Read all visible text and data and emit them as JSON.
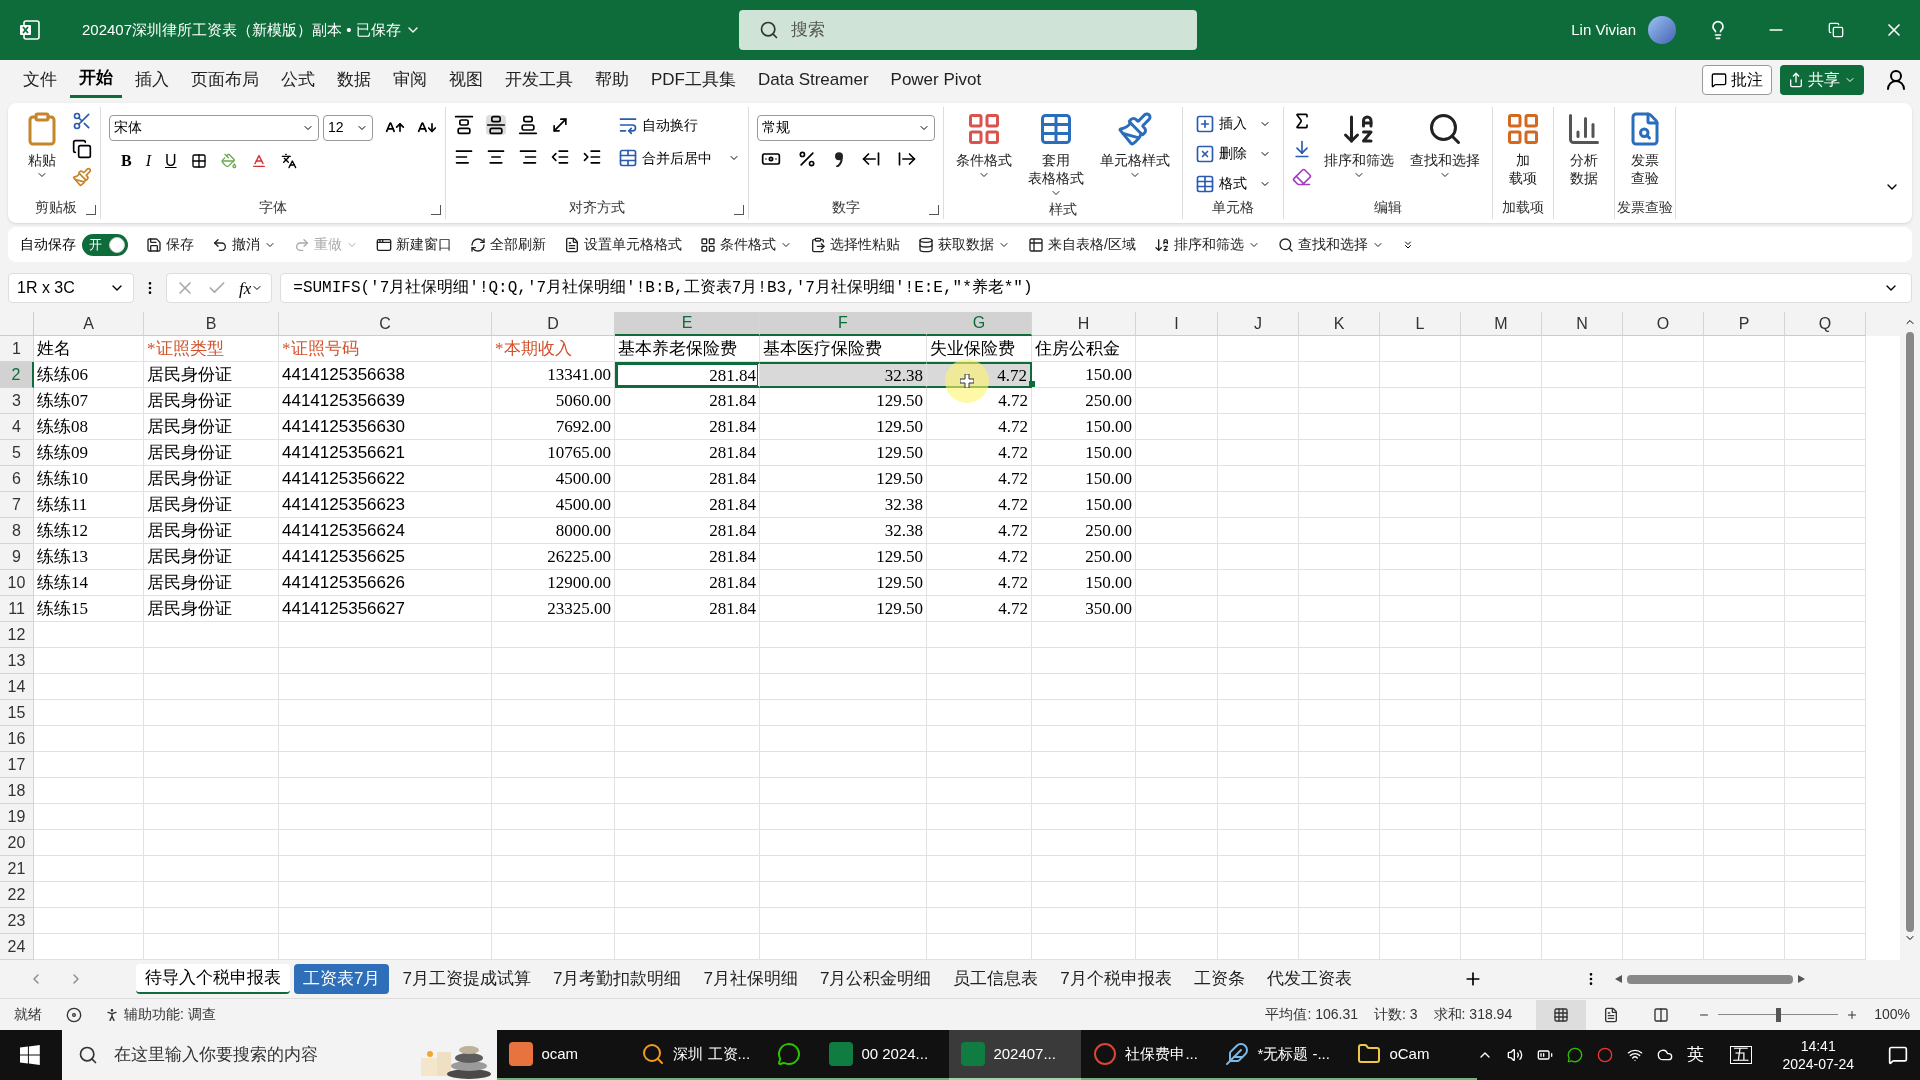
{
  "window": {
    "title": "202407深圳律所工资表（新模版）副本 • 已保存",
    "search_placeholder": "搜索",
    "user": "Lin Vivian"
  },
  "menu": {
    "tabs": [
      {
        "label": "文件",
        "selected": false
      },
      {
        "label": "开始",
        "selected": true
      },
      {
        "label": "插入",
        "selected": false
      },
      {
        "label": "页面布局",
        "selected": false
      },
      {
        "label": "公式",
        "selected": false
      },
      {
        "label": "数据",
        "selected": false
      },
      {
        "label": "审阅",
        "selected": false
      },
      {
        "label": "视图",
        "selected": false
      },
      {
        "label": "开发工具",
        "selected": false
      },
      {
        "label": "帮助",
        "selected": false
      },
      {
        "label": "PDF工具集",
        "selected": false
      },
      {
        "label": "Data Streamer",
        "selected": false
      },
      {
        "label": "Power Pivot",
        "selected": false
      }
    ],
    "comment": "批注",
    "share": "共享"
  },
  "ribbon": [
    {
      "kind": "clipboard",
      "name": "剪贴板",
      "paste": "粘贴"
    },
    {
      "kind": "font",
      "name": "字体",
      "font": "宋体",
      "size": "12",
      "bold": "B",
      "italic": "I",
      "underline": "U"
    },
    {
      "kind": "alignment",
      "name": "对齐方式",
      "wrap": "自动换行",
      "merge": "合并后居中"
    },
    {
      "kind": "number",
      "name": "数字",
      "format": "常规"
    },
    {
      "kind": "styles",
      "name": "样式",
      "buttons": [
        [
          "条件格式"
        ],
        [
          "套用",
          "表格格式"
        ],
        [
          "单元格样式"
        ]
      ]
    },
    {
      "kind": "cells",
      "name": "单元格",
      "buttons": [
        "插入",
        "删除",
        "格式"
      ]
    },
    {
      "kind": "editing",
      "name": "编辑",
      "buttons": [
        "排序和筛选",
        "查找和选择"
      ]
    },
    {
      "kind": "addins",
      "name": "加载项",
      "label": [
        "加",
        "载项"
      ]
    },
    {
      "kind": "analysis",
      "label": [
        "分析",
        "数据"
      ]
    },
    {
      "kind": "invoice",
      "name": "发票查验",
      "label": [
        "发票",
        "查验"
      ]
    }
  ],
  "quick_access": {
    "autosave": "自动保存",
    "toggle": {
      "label": "开",
      "on": true
    },
    "items": [
      {
        "kind": "save",
        "label": "保存",
        "disabled": false,
        "dropdown": false
      },
      {
        "kind": "undo",
        "label": "撤消",
        "disabled": false,
        "dropdown": true
      },
      {
        "kind": "redo",
        "label": "重做",
        "disabled": true,
        "dropdown": true
      },
      {
        "kind": "window",
        "label": "新建窗口",
        "disabled": false,
        "dropdown": false
      },
      {
        "kind": "refresh",
        "label": "全部刷新",
        "disabled": false,
        "dropdown": false
      },
      {
        "kind": "format",
        "label": "设置单元格格式",
        "disabled": false,
        "dropdown": false
      },
      {
        "kind": "conditional",
        "label": "条件格式",
        "disabled": false,
        "dropdown": true
      },
      {
        "kind": "paste",
        "label": "选择性粘贴",
        "disabled": false,
        "dropdown": false
      },
      {
        "kind": "data",
        "label": "获取数据",
        "disabled": false,
        "dropdown": true
      },
      {
        "kind": "table",
        "label": "来自表格/区域",
        "disabled": false,
        "dropdown": false
      },
      {
        "kind": "sort",
        "label": "排序和筛选",
        "disabled": false,
        "dropdown": true
      },
      {
        "kind": "find",
        "label": "查找和选择",
        "disabled": false,
        "dropdown": true
      }
    ]
  },
  "formula_bar": {
    "name_box": "1R x 3C",
    "fx": "fx",
    "formula": "=SUMIFS('7月社保明细'!Q:Q,'7月社保明细'!B:B,工资表7月!B3,'7月社保明细'!E:E,\"*养老*\")"
  },
  "grid": {
    "columns": [
      {
        "letter": "A",
        "kind": "text",
        "selected": false
      },
      {
        "letter": "B",
        "kind": "text",
        "selected": false
      },
      {
        "letter": "C",
        "kind": "id",
        "selected": false
      },
      {
        "letter": "D",
        "kind": "number",
        "selected": false
      },
      {
        "letter": "E",
        "kind": "number",
        "selected": true
      },
      {
        "letter": "F",
        "kind": "number",
        "selected": true
      },
      {
        "letter": "G",
        "kind": "number",
        "selected": true
      },
      {
        "letter": "H",
        "kind": "number",
        "selected": false
      },
      {
        "letter": "I",
        "kind": "text",
        "selected": false
      },
      {
        "letter": "J",
        "kind": "text",
        "selected": false
      },
      {
        "letter": "K",
        "kind": "text",
        "selected": false
      },
      {
        "letter": "L",
        "kind": "text",
        "selected": false
      },
      {
        "letter": "M",
        "kind": "text",
        "selected": false
      },
      {
        "letter": "N",
        "kind": "text",
        "selected": false
      },
      {
        "letter": "O",
        "kind": "text",
        "selected": false
      },
      {
        "letter": "P",
        "kind": "text",
        "selected": false
      },
      {
        "letter": "Q",
        "kind": "text",
        "selected": false
      }
    ],
    "rows": [
      {
        "number": "1",
        "selected": false,
        "cells": [
          {
            "text": "姓名",
            "required": false,
            "selected": false,
            "active": false
          },
          {
            "text": "*证照类型",
            "required": true,
            "selected": false,
            "active": false
          },
          {
            "text": "*证照号码",
            "required": true,
            "selected": false,
            "active": false
          },
          {
            "text": "*本期收入",
            "required": true,
            "selected": false,
            "active": false
          },
          {
            "text": "基本养老保险费",
            "required": false,
            "selected": false,
            "active": false
          },
          {
            "text": "基本医疗保险费",
            "required": false,
            "selected": false,
            "active": false
          },
          {
            "text": "失业保险费",
            "required": false,
            "selected": false,
            "active": false
          },
          {
            "text": "住房公积金",
            "required": false,
            "selected": false,
            "active": false
          }
        ]
      },
      {
        "number": "2",
        "selected": true,
        "cells": [
          {
            "text": "练练06",
            "selected": false,
            "active": false
          },
          {
            "text": "居民身份证",
            "selected": false,
            "active": false
          },
          {
            "text": "4414125356638",
            "selected": false,
            "active": false
          },
          {
            "text": "13341.00",
            "selected": false,
            "active": false
          },
          {
            "text": "281.84",
            "selected": true,
            "active": true
          },
          {
            "text": "32.38",
            "selected": true,
            "active": false
          },
          {
            "text": "4.72",
            "selected": true,
            "active": false
          },
          {
            "text": "150.00",
            "selected": false,
            "active": false
          }
        ]
      },
      {
        "number": "3",
        "selected": false,
        "cells": [
          {
            "text": "练练07",
            "selected": false,
            "active": false
          },
          {
            "text": "居民身份证",
            "selected": false,
            "active": false
          },
          {
            "text": "4414125356639",
            "selected": false,
            "active": false
          },
          {
            "text": "5060.00",
            "selected": false,
            "active": false
          },
          {
            "text": "281.84",
            "selected": false,
            "active": false
          },
          {
            "text": "129.50",
            "selected": false,
            "active": false
          },
          {
            "text": "4.72",
            "selected": false,
            "active": false
          },
          {
            "text": "250.00",
            "selected": false,
            "active": false
          }
        ]
      },
      {
        "number": "4",
        "selected": false,
        "cells": [
          {
            "text": "练练08",
            "selected": false,
            "active": false
          },
          {
            "text": "居民身份证",
            "selected": false,
            "active": false
          },
          {
            "text": "4414125356630",
            "selected": false,
            "active": false
          },
          {
            "text": "7692.00",
            "selected": false,
            "active": false
          },
          {
            "text": "281.84",
            "selected": false,
            "active": false
          },
          {
            "text": "129.50",
            "selected": false,
            "active": false
          },
          {
            "text": "4.72",
            "selected": false,
            "active": false
          },
          {
            "text": "150.00",
            "selected": false,
            "active": false
          }
        ]
      },
      {
        "number": "5",
        "selected": false,
        "cells": [
          {
            "text": "练练09",
            "selected": false,
            "active": false
          },
          {
            "text": "居民身份证",
            "selected": false,
            "active": false
          },
          {
            "text": "4414125356621",
            "selected": false,
            "active": false
          },
          {
            "text": "10765.00",
            "selected": false,
            "active": false
          },
          {
            "text": "281.84",
            "selected": false,
            "active": false
          },
          {
            "text": "129.50",
            "selected": false,
            "active": false
          },
          {
            "text": "4.72",
            "selected": false,
            "active": false
          },
          {
            "text": "150.00",
            "selected": false,
            "active": false
          }
        ]
      },
      {
        "number": "6",
        "selected": false,
        "cells": [
          {
            "text": "练练10",
            "selected": false,
            "active": false
          },
          {
            "text": "居民身份证",
            "selected": false,
            "active": false
          },
          {
            "text": "4414125356622",
            "selected": false,
            "active": false
          },
          {
            "text": "4500.00",
            "selected": false,
            "active": false
          },
          {
            "text": "281.84",
            "selected": false,
            "active": false
          },
          {
            "text": "129.50",
            "selected": false,
            "active": false
          },
          {
            "text": "4.72",
            "selected": false,
            "active": false
          },
          {
            "text": "150.00",
            "selected": false,
            "active": false
          }
        ]
      },
      {
        "number": "7",
        "selected": false,
        "cells": [
          {
            "text": "练练11",
            "selected": false,
            "active": false
          },
          {
            "text": "居民身份证",
            "selected": false,
            "active": false
          },
          {
            "text": "4414125356623",
            "selected": false,
            "active": false
          },
          {
            "text": "4500.00",
            "selected": false,
            "active": false
          },
          {
            "text": "281.84",
            "selected": false,
            "active": false
          },
          {
            "text": "32.38",
            "selected": false,
            "active": false
          },
          {
            "text": "4.72",
            "selected": false,
            "active": false
          },
          {
            "text": "150.00",
            "selected": false,
            "active": false
          }
        ]
      },
      {
        "number": "8",
        "selected": false,
        "cells": [
          {
            "text": "练练12",
            "selected": false,
            "active": false
          },
          {
            "text": "居民身份证",
            "selected": false,
            "active": false
          },
          {
            "text": "4414125356624",
            "selected": false,
            "active": false
          },
          {
            "text": "8000.00",
            "selected": false,
            "active": false
          },
          {
            "text": "281.84",
            "selected": false,
            "active": false
          },
          {
            "text": "32.38",
            "selected": false,
            "active": false
          },
          {
            "text": "4.72",
            "selected": false,
            "active": false
          },
          {
            "text": "250.00",
            "selected": false,
            "active": false
          }
        ]
      },
      {
        "number": "9",
        "selected": false,
        "cells": [
          {
            "text": "练练13",
            "selected": false,
            "active": false
          },
          {
            "text": "居民身份证",
            "selected": false,
            "active": false
          },
          {
            "text": "4414125356625",
            "selected": false,
            "active": false
          },
          {
            "text": "26225.00",
            "selected": false,
            "active": false
          },
          {
            "text": "281.84",
            "selected": false,
            "active": false
          },
          {
            "text": "129.50",
            "selected": false,
            "active": false
          },
          {
            "text": "4.72",
            "selected": false,
            "active": false
          },
          {
            "text": "250.00",
            "selected": false,
            "active": false
          }
        ]
      },
      {
        "number": "10",
        "selected": false,
        "cells": [
          {
            "text": "练练14",
            "selected": false,
            "active": false
          },
          {
            "text": "居民身份证",
            "selected": false,
            "active": false
          },
          {
            "text": "4414125356626",
            "selected": false,
            "active": false
          },
          {
            "text": "12900.00",
            "selected": false,
            "active": false
          },
          {
            "text": "281.84",
            "selected": false,
            "active": false
          },
          {
            "text": "129.50",
            "selected": false,
            "active": false
          },
          {
            "text": "4.72",
            "selected": false,
            "active": false
          },
          {
            "text": "150.00",
            "selected": false,
            "active": false
          }
        ]
      },
      {
        "number": "11",
        "selected": false,
        "cells": [
          {
            "text": "练练15",
            "selected": false,
            "active": false
          },
          {
            "text": "居民身份证",
            "selected": false,
            "active": false
          },
          {
            "text": "4414125356627",
            "selected": false,
            "active": false
          },
          {
            "text": "23325.00",
            "selected": false,
            "active": false
          },
          {
            "text": "281.84",
            "selected": false,
            "active": false
          },
          {
            "text": "129.50",
            "selected": false,
            "active": false
          },
          {
            "text": "4.72",
            "selected": false,
            "active": false
          },
          {
            "text": "350.00",
            "selected": false,
            "active": false
          }
        ]
      },
      {
        "number": "12",
        "selected": false,
        "cells": []
      },
      {
        "number": "13",
        "selected": false,
        "cells": []
      },
      {
        "number": "14",
        "selected": false,
        "cells": []
      },
      {
        "number": "15",
        "selected": false,
        "cells": []
      },
      {
        "number": "16",
        "selected": false,
        "cells": []
      },
      {
        "number": "17",
        "selected": false,
        "cells": []
      },
      {
        "number": "18",
        "selected": false,
        "cells": []
      },
      {
        "number": "19",
        "selected": false,
        "cells": []
      },
      {
        "number": "20",
        "selected": false,
        "cells": []
      },
      {
        "number": "21",
        "selected": false,
        "cells": []
      },
      {
        "number": "22",
        "selected": false,
        "cells": []
      },
      {
        "number": "23",
        "selected": false,
        "cells": []
      },
      {
        "number": "24",
        "selected": false,
        "cells": []
      }
    ]
  },
  "sheet_tabs": [
    {
      "label": "待导入个税申报表",
      "selected": true
    },
    {
      "label": "工资表7月",
      "selected": false,
      "color": "#2f6fba"
    },
    {
      "label": "7月工资提成试算",
      "selected": false
    },
    {
      "label": "7月考勤扣款明细",
      "selected": false
    },
    {
      "label": "7月社保明细",
      "selected": false
    },
    {
      "label": "7月公积金明细",
      "selected": false
    },
    {
      "label": "员工信息表",
      "selected": false
    },
    {
      "label": "7月个税申报表",
      "selected": false
    },
    {
      "label": "工资条",
      "selected": false
    },
    {
      "label": "代发工资表",
      "selected": false
    }
  ],
  "status_bar": {
    "ready": "就绪",
    "accessibility": "辅助功能: 调查",
    "average": "平均值: 106.31",
    "count": "计数: 3",
    "sum": "求和: 318.94",
    "views": [
      {
        "kind": "normal",
        "selected": true
      },
      {
        "kind": "layout",
        "selected": false
      },
      {
        "kind": "break",
        "selected": false
      }
    ],
    "zoom": {
      "level": 0.5,
      "reading": "100%"
    }
  },
  "taskbar": {
    "search_placeholder": "在这里输入你要搜索的内容",
    "apps": [
      {
        "kind": "ocam",
        "label": "ocam",
        "selected": false
      },
      {
        "kind": "search",
        "label": "深圳 工资...",
        "selected": false
      },
      {
        "kind": "wechat",
        "selected": false
      },
      {
        "kind": "excel",
        "label": "00 2024...",
        "selected": false
      },
      {
        "kind": "excel",
        "label": "202407...",
        "selected": true
      },
      {
        "kind": "chrome",
        "label": "社保费申...",
        "selected": false
      },
      {
        "kind": "notepad",
        "label": "*无标题 -...",
        "selected": false
      },
      {
        "kind": "folder",
        "label": "oCam",
        "selected": false
      }
    ],
    "input_lang": "英",
    "ime": "五",
    "time": "14:41",
    "date": "2024-07-24"
  }
}
